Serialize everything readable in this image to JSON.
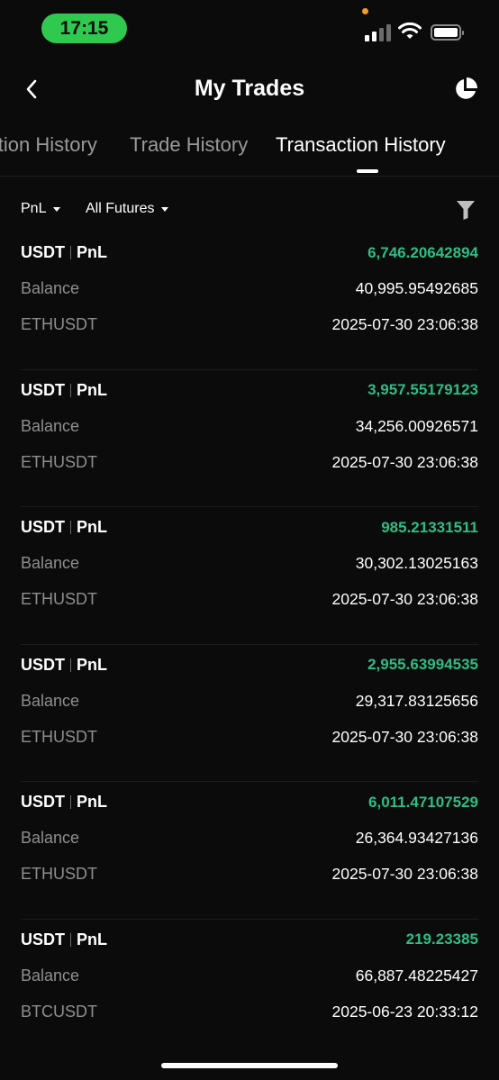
{
  "status_bar": {
    "time": "17:15"
  },
  "header": {
    "title": "My Trades"
  },
  "tabs": [
    {
      "label": "Position History"
    },
    {
      "label": "Trade History"
    },
    {
      "label": "Transaction History",
      "active": true
    }
  ],
  "filters": {
    "type": "PnL",
    "market": "All Futures"
  },
  "records": [
    {
      "currency": "USDT",
      "kind": "PnL",
      "pnl": "6,746.20642894",
      "balance_label": "Balance",
      "balance": "40,995.95492685",
      "symbol": "ETHUSDT",
      "time": "2025-07-30 23:06:38"
    },
    {
      "currency": "USDT",
      "kind": "PnL",
      "pnl": "3,957.55179123",
      "balance_label": "Balance",
      "balance": "34,256.00926571",
      "symbol": "ETHUSDT",
      "time": "2025-07-30 23:06:38"
    },
    {
      "currency": "USDT",
      "kind": "PnL",
      "pnl": "985.21331511",
      "balance_label": "Balance",
      "balance": "30,302.13025163",
      "symbol": "ETHUSDT",
      "time": "2025-07-30 23:06:38"
    },
    {
      "currency": "USDT",
      "kind": "PnL",
      "pnl": "2,955.63994535",
      "balance_label": "Balance",
      "balance": "29,317.83125656",
      "symbol": "ETHUSDT",
      "time": "2025-07-30 23:06:38"
    },
    {
      "currency": "USDT",
      "kind": "PnL",
      "pnl": "6,011.47107529",
      "balance_label": "Balance",
      "balance": "26,364.93427136",
      "symbol": "ETHUSDT",
      "time": "2025-07-30 23:06:38"
    },
    {
      "currency": "USDT",
      "kind": "PnL",
      "pnl": "219.23385",
      "balance_label": "Balance",
      "balance": "66,887.48225427",
      "symbol": "BTCUSDT",
      "time": "2025-06-23 20:33:12"
    }
  ],
  "colors": {
    "positive": "#2ebd85",
    "status_pill": "#2fc94f",
    "background": "#0b0b0b"
  }
}
